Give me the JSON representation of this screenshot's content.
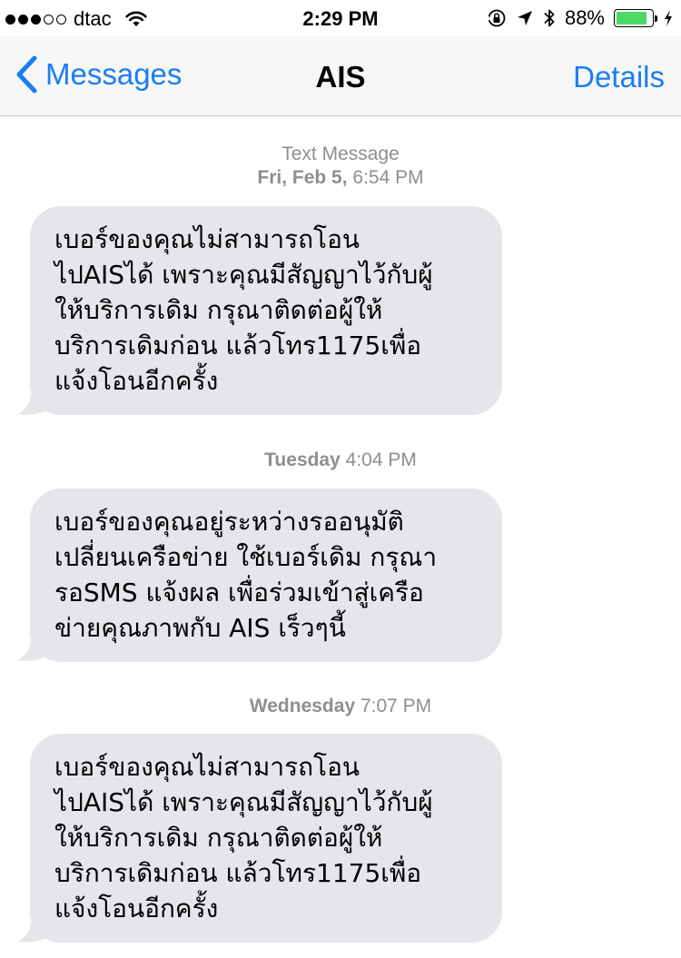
{
  "status_bar": {
    "signal": [
      true,
      true,
      true,
      false,
      false
    ],
    "carrier": "dtac",
    "time": "2:29 PM",
    "battery_percent": "88%",
    "battery_level": 0.88,
    "battery_color": "#4cd964",
    "icons": [
      "wifi-icon",
      "orientation-lock-icon",
      "location-arrow-icon",
      "bluetooth-icon",
      "battery-icon",
      "charging-bolt-icon"
    ]
  },
  "nav": {
    "back_label": "Messages",
    "title": "AIS",
    "details_label": "Details",
    "accent_color": "#1a7ef3"
  },
  "thread": {
    "header_label": "Text Message",
    "groups": [
      {
        "day": "Fri, Feb 5,",
        "time": "6:54 PM",
        "lines": [
          "เบอร์ของคุณไม่สามารถโอน",
          "ไปAISได้ เพราะคุณมีสัญญาไว้กับผู้",
          "ให้บริการเดิม กรุณาติดต่อผู้ให้",
          "บริการเดิมก่อน แล้วโทร1175เพื่อ",
          "แจ้งโอนอีกครั้ง"
        ]
      },
      {
        "day": "Tuesday",
        "time": "4:04 PM",
        "lines": [
          "เบอร์ของคุณอยู่ระหว่างรออนุมัติ",
          "เปลี่ยนเครือข่าย ใช้เบอร์เดิม กรุณา",
          "รอSMS แจ้งผล เพื่อร่วมเข้าสู่เครือ",
          "ข่ายคุณภาพกับ AIS เร็วๆนี้"
        ]
      },
      {
        "day": "Wednesday",
        "time": "7:07 PM",
        "lines": [
          "เบอร์ของคุณไม่สามารถโอน",
          "ไปAISได้ เพราะคุณมีสัญญาไว้กับผู้",
          "ให้บริการเดิม กรุณาติดต่อผู้ให้",
          "บริการเดิมก่อน แล้วโทร1175เพื่อ",
          "แจ้งโอนอีกครั้ง"
        ]
      }
    ],
    "bubble_color": "#e5e5ea"
  }
}
